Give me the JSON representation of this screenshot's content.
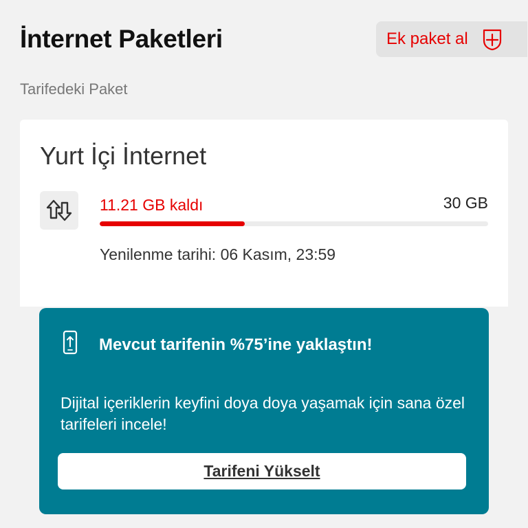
{
  "header": {
    "title": "İnternet Paketleri",
    "add_package_label": "Ek paket al"
  },
  "section": {
    "label": "Tarifedeki Paket"
  },
  "package": {
    "name": "Yurt İçi İnternet",
    "remaining_text": "11.21 GB kaldı",
    "total_text": "30 GB",
    "remaining_fraction": 0.3737,
    "renewal_text": "Yenilenme tarihi: 06 Kasım, 23:59"
  },
  "promo": {
    "title": "Mevcut tarifenin %75’ine yaklaştın!",
    "description": "Dijital içeriklerin keyfini doya doya yaşamak için sana özel tarifeleri incele!",
    "button_label": "Tarifeni Yükselt"
  },
  "icons": {
    "add": "plus-circle-icon",
    "data": "data-transfer-arrows-icon",
    "phone": "phone-upload-icon"
  },
  "colors": {
    "accent_red": "#e60000",
    "promo_teal": "#007c92",
    "background": "#f2f2f2"
  }
}
